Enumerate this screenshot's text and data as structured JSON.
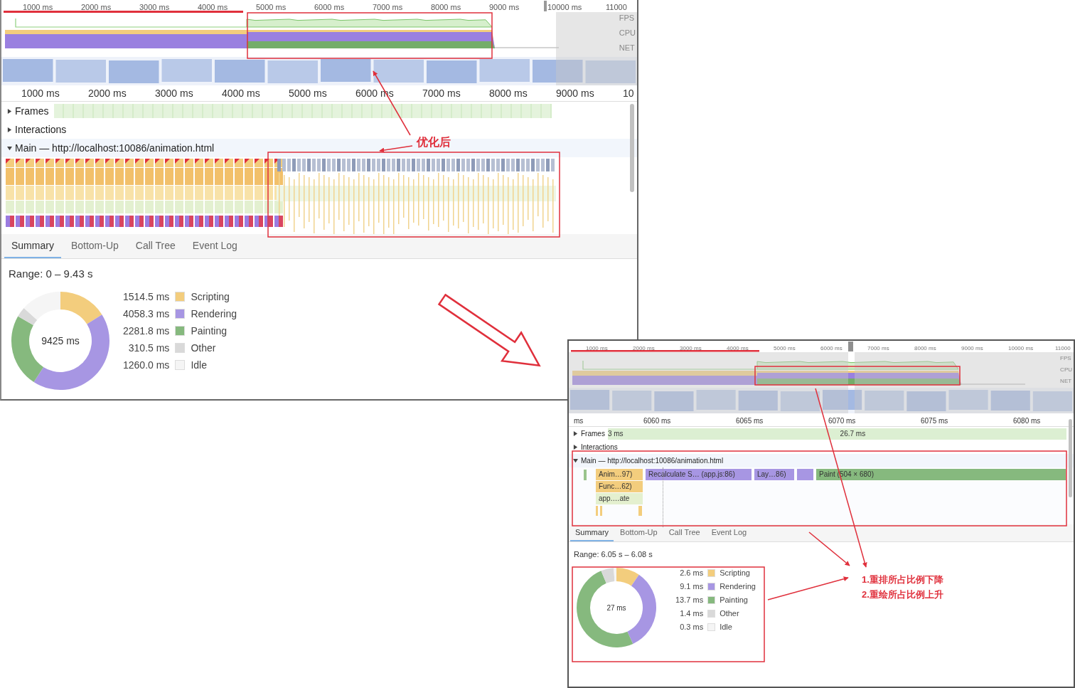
{
  "panels": [
    {
      "overview": {
        "ticks": [
          "1000 ms",
          "2000 ms",
          "3000 ms",
          "4000 ms",
          "5000 ms",
          "6000 ms",
          "7000 ms",
          "8000 ms",
          "9000 ms",
          "10000 ms",
          "11000"
        ],
        "lanes": [
          "FPS",
          "CPU",
          "NET"
        ]
      },
      "ruler": [
        "1000 ms",
        "2000 ms",
        "3000 ms",
        "4000 ms",
        "5000 ms",
        "6000 ms",
        "7000 ms",
        "8000 ms",
        "9000 ms",
        "10"
      ],
      "tracks": [
        {
          "kind": "frames",
          "label": "Frames",
          "expanded": false
        },
        {
          "kind": "interactions",
          "label": "Interactions",
          "expanded": false
        },
        {
          "kind": "main",
          "label": "Main — http://localhost:10086/animation.html",
          "expanded": true
        }
      ],
      "tabs": [
        {
          "label": "Summary",
          "selected": true
        },
        {
          "label": "Bottom-Up",
          "selected": false
        },
        {
          "label": "Call Tree",
          "selected": false
        },
        {
          "label": "Event Log",
          "selected": false
        }
      ],
      "summary": {
        "range": "Range: 0 – 9.43 s",
        "total": "9425 ms",
        "items": [
          {
            "value": "1514.5 ms",
            "color": "#f3cd7d"
          },
          {
            "value": "4058.3 ms",
            "color": "#a796e3"
          },
          {
            "value": "2281.8 ms",
            "color": "#86b97e"
          },
          {
            "value": "310.5 ms",
            "color": "#d9d9d9"
          },
          {
            "value": "1260.0 ms",
            "color": "#f5f5f5"
          }
        ],
        "chart_data": {
          "type": "donut",
          "categories": [
            "Scripting",
            "Rendering",
            "Painting",
            "Other",
            "Idle"
          ],
          "series": [
            {
              "values": [
                16.07,
                43.06,
                24.21,
                3.29,
                13.37
              ]
            }
          ]
        }
      }
    },
    {
      "overview": {
        "ticks": [
          "1000 ms",
          "2000 ms",
          "3000 ms",
          "4000 ms",
          "5000 ms",
          "6000 ms",
          "7000 ms",
          "8000 ms",
          "9000 ms",
          "10000 ms",
          "11000"
        ],
        "lanes": [
          "FPS",
          "CPU",
          "NET"
        ]
      },
      "ruler": [
        "ms",
        "6060 ms",
        "6065 ms",
        "6070 ms",
        "6075 ms",
        "6080 ms"
      ],
      "tracks": [
        {
          "kind": "frames",
          "label": "Frames",
          "expanded": false,
          "durations": [
            "3 ms",
            "26.7 ms"
          ]
        },
        {
          "kind": "interactions",
          "label": "Interactions",
          "expanded": false
        },
        {
          "kind": "main",
          "label": "Main — http://localhost:10086/animation.html",
          "expanded": true,
          "flame": [
            [
              {
                "kind": "scripting",
                "text": "Anim…97)"
              },
              {
                "kind": "rendering",
                "text": "Recalculate S… (app.js:86)"
              },
              {
                "kind": "rendering",
                "text": "Lay…86)"
              },
              {
                "kind": "rendering"
              },
              {
                "kind": "painting",
                "text": "Paint (504 × 680)"
              }
            ],
            [
              {
                "kind": "scripting",
                "text": "Func…62)"
              }
            ],
            [
              {
                "kind": "call",
                "text": "app.…ate"
              }
            ]
          ]
        }
      ],
      "tabs": [
        {
          "label": "Summary",
          "selected": true
        },
        {
          "label": "Bottom-Up",
          "selected": false
        },
        {
          "label": "Call Tree",
          "selected": false
        },
        {
          "label": "Event Log",
          "selected": false
        }
      ],
      "summary": {
        "range": "Range: 6.05 s – 6.08 s",
        "total": "27 ms",
        "items": [
          {
            "value": "2.6 ms",
            "color": "#f3cd7d"
          },
          {
            "value": "9.1 ms",
            "color": "#a796e3"
          },
          {
            "value": "13.7 ms",
            "color": "#86b97e"
          },
          {
            "value": "1.4 ms",
            "color": "#d9d9d9"
          },
          {
            "value": "0.3 ms",
            "color": "#f5f5f5"
          }
        ],
        "chart_data": {
          "type": "donut",
          "categories": [
            "Scripting",
            "Rendering",
            "Painting",
            "Other",
            "Idle"
          ],
          "series": [
            {
              "values": [
                9.59,
                33.58,
                50.55,
                5.17,
                1.11
              ]
            }
          ]
        }
      }
    }
  ],
  "annotations": [
    {
      "text": "优化后"
    },
    {
      "text": "1.重排所占比例下降"
    },
    {
      "text": "2.重绘所占比例上升"
    }
  ]
}
